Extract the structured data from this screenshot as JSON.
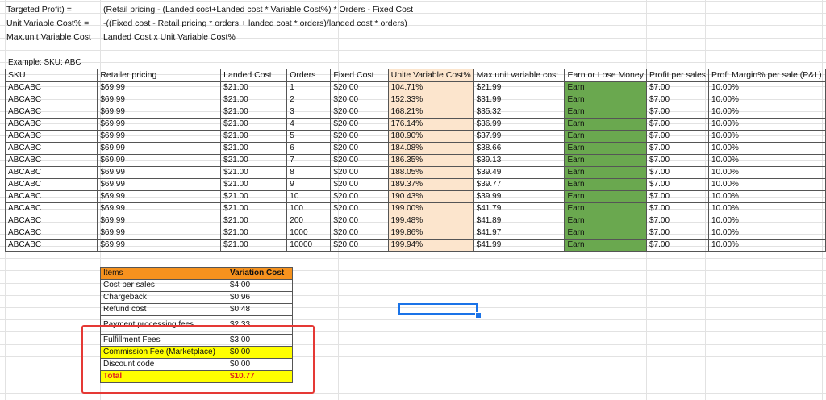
{
  "formulas": [
    {
      "label": "Targeted Profit) =",
      "expr": "(Retail pricing - (Landed cost+Landed cost * Variable Cost%) * Orders - Fixed Cost"
    },
    {
      "label": "Unit Variable Cost% =",
      "expr": "-((Fixed cost - Retail pricing * orders + landed cost * orders)/landed cost * orders)"
    },
    {
      "label": "Max.unit Variable Cost",
      "expr": "Landed Cost x Unit Variable Cost%"
    }
  ],
  "example_label": "Example: SKU: ABC",
  "table": {
    "headers": [
      "SKU",
      "Retailer pricing",
      "Landed Cost",
      "Orders",
      "Fixed Cost",
      "Unite Variable Cost%",
      "Max.unit variable cost",
      "Earn or Lose Money",
      "Profit per sales",
      "Proft Margin% per sale (P&L)"
    ],
    "rows": [
      [
        "ABCABC",
        "$69.99",
        "$21.00",
        "1",
        "$20.00",
        "104.71%",
        "$21.99",
        "Earn",
        "$7.00",
        "10.00%"
      ],
      [
        "ABCABC",
        "$69.99",
        "$21.00",
        "2",
        "$20.00",
        "152.33%",
        "$31.99",
        "Earn",
        "$7.00",
        "10.00%"
      ],
      [
        "ABCABC",
        "$69.99",
        "$21.00",
        "3",
        "$20.00",
        "168.21%",
        "$35.32",
        "Earn",
        "$7.00",
        "10.00%"
      ],
      [
        "ABCABC",
        "$69.99",
        "$21.00",
        "4",
        "$20.00",
        "176.14%",
        "$36.99",
        "Earn",
        "$7.00",
        "10.00%"
      ],
      [
        "ABCABC",
        "$69.99",
        "$21.00",
        "5",
        "$20.00",
        "180.90%",
        "$37.99",
        "Earn",
        "$7.00",
        "10.00%"
      ],
      [
        "ABCABC",
        "$69.99",
        "$21.00",
        "6",
        "$20.00",
        "184.08%",
        "$38.66",
        "Earn",
        "$7.00",
        "10.00%"
      ],
      [
        "ABCABC",
        "$69.99",
        "$21.00",
        "7",
        "$20.00",
        "186.35%",
        "$39.13",
        "Earn",
        "$7.00",
        "10.00%"
      ],
      [
        "ABCABC",
        "$69.99",
        "$21.00",
        "8",
        "$20.00",
        "188.05%",
        "$39.49",
        "Earn",
        "$7.00",
        "10.00%"
      ],
      [
        "ABCABC",
        "$69.99",
        "$21.00",
        "9",
        "$20.00",
        "189.37%",
        "$39.77",
        "Earn",
        "$7.00",
        "10.00%"
      ],
      [
        "ABCABC",
        "$69.99",
        "$21.00",
        "10",
        "$20.00",
        "190.43%",
        "$39.99",
        "Earn",
        "$7.00",
        "10.00%"
      ],
      [
        "ABCABC",
        "$69.99",
        "$21.00",
        "100",
        "$20.00",
        "199.00%",
        "$41.79",
        "Earn",
        "$7.00",
        "10.00%"
      ],
      [
        "ABCABC",
        "$69.99",
        "$21.00",
        "200",
        "$20.00",
        "199.48%",
        "$41.89",
        "Earn",
        "$7.00",
        "10.00%"
      ],
      [
        "ABCABC",
        "$69.99",
        "$21.00",
        "1000",
        "$20.00",
        "199.86%",
        "$41.97",
        "Earn",
        "$7.00",
        "10.00%"
      ],
      [
        "ABCABC",
        "$69.99",
        "$21.00",
        "10000",
        "$20.00",
        "199.94%",
        "$41.99",
        "Earn",
        "$7.00",
        "10.00%"
      ]
    ]
  },
  "fees": {
    "headers": [
      "Items",
      "Variation Cost"
    ],
    "rows": [
      {
        "item": "Cost per sales",
        "cost": "$4.00",
        "style": ""
      },
      {
        "item": "Chargeback",
        "cost": "$0.96",
        "style": ""
      },
      {
        "item": "Refund cost",
        "cost": "$0.48",
        "style": ""
      },
      {
        "item": "Payment processing fees",
        "cost": "$2.33",
        "style": "clipped"
      },
      {
        "item": "Fulfillment Fees",
        "cost": "$3.00",
        "style": ""
      },
      {
        "item": "Commission Fee (Marketplace)",
        "cost": "$0.00",
        "style": "yellow"
      },
      {
        "item": "Discount code",
        "cost": "$0.00",
        "style": ""
      },
      {
        "item": "Total",
        "cost": "$10.77",
        "style": "total"
      }
    ]
  },
  "colors": {
    "variable_cost_fill": "#fce5cd",
    "earn_fill": "#6aa84f",
    "fees_header_fill": "#f6921e",
    "highlight_fill": "#ffff00",
    "total_text": "#e02020",
    "selection": "#1a73e8",
    "annotation_box": "#e53935"
  }
}
